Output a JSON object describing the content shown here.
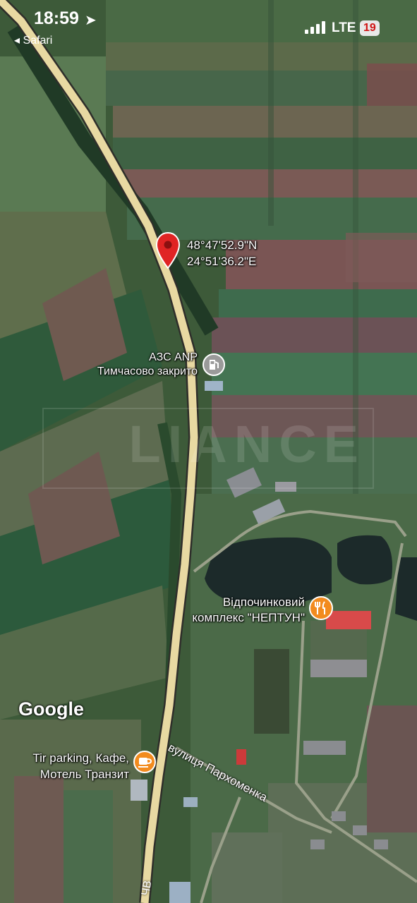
{
  "status_bar": {
    "time": "18:59",
    "back_app": "Safari",
    "network": "LTE",
    "battery": "19"
  },
  "pin": {
    "lat": "48°47'52.9\"N",
    "lon": "24°51'36.2\"E",
    "icon": "location-pin-icon",
    "color": "#e02424"
  },
  "pois": [
    {
      "name": "АЗС ANP",
      "sub": "Тимчасово закрито",
      "icon": "gas-station-icon"
    },
    {
      "name": "Відпочинковий",
      "sub": "комплекс \"НЕПТУН\"",
      "icon": "restaurant-icon",
      "color": "#f28b1e"
    },
    {
      "name": "Tir parking, Кафе,",
      "sub": "Мотель Транзит",
      "icon": "cafe-icon",
      "color": "#f28b1e"
    }
  ],
  "streets": {
    "main": "вулиця Пархоменка",
    "bottom": "ЧВ"
  },
  "logo": "Google",
  "watermark": "LIANCE"
}
